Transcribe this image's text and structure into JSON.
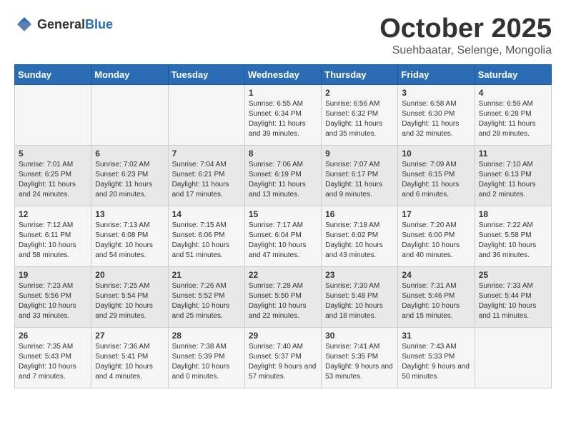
{
  "header": {
    "logo_general": "General",
    "logo_blue": "Blue",
    "month": "October 2025",
    "location": "Suehbaatar, Selenge, Mongolia"
  },
  "days_of_week": [
    "Sunday",
    "Monday",
    "Tuesday",
    "Wednesday",
    "Thursday",
    "Friday",
    "Saturday"
  ],
  "weeks": [
    [
      {
        "day": "",
        "info": ""
      },
      {
        "day": "",
        "info": ""
      },
      {
        "day": "",
        "info": ""
      },
      {
        "day": "1",
        "info": "Sunrise: 6:55 AM\nSunset: 6:34 PM\nDaylight: 11 hours\nand 39 minutes."
      },
      {
        "day": "2",
        "info": "Sunrise: 6:56 AM\nSunset: 6:32 PM\nDaylight: 11 hours\nand 35 minutes."
      },
      {
        "day": "3",
        "info": "Sunrise: 6:58 AM\nSunset: 6:30 PM\nDaylight: 11 hours\nand 32 minutes."
      },
      {
        "day": "4",
        "info": "Sunrise: 6:59 AM\nSunset: 6:28 PM\nDaylight: 11 hours\nand 28 minutes."
      }
    ],
    [
      {
        "day": "5",
        "info": "Sunrise: 7:01 AM\nSunset: 6:25 PM\nDaylight: 11 hours\nand 24 minutes."
      },
      {
        "day": "6",
        "info": "Sunrise: 7:02 AM\nSunset: 6:23 PM\nDaylight: 11 hours\nand 20 minutes."
      },
      {
        "day": "7",
        "info": "Sunrise: 7:04 AM\nSunset: 6:21 PM\nDaylight: 11 hours\nand 17 minutes."
      },
      {
        "day": "8",
        "info": "Sunrise: 7:06 AM\nSunset: 6:19 PM\nDaylight: 11 hours\nand 13 minutes."
      },
      {
        "day": "9",
        "info": "Sunrise: 7:07 AM\nSunset: 6:17 PM\nDaylight: 11 hours\nand 9 minutes."
      },
      {
        "day": "10",
        "info": "Sunrise: 7:09 AM\nSunset: 6:15 PM\nDaylight: 11 hours\nand 6 minutes."
      },
      {
        "day": "11",
        "info": "Sunrise: 7:10 AM\nSunset: 6:13 PM\nDaylight: 11 hours\nand 2 minutes."
      }
    ],
    [
      {
        "day": "12",
        "info": "Sunrise: 7:12 AM\nSunset: 6:11 PM\nDaylight: 10 hours\nand 58 minutes."
      },
      {
        "day": "13",
        "info": "Sunrise: 7:13 AM\nSunset: 6:08 PM\nDaylight: 10 hours\nand 54 minutes."
      },
      {
        "day": "14",
        "info": "Sunrise: 7:15 AM\nSunset: 6:06 PM\nDaylight: 10 hours\nand 51 minutes."
      },
      {
        "day": "15",
        "info": "Sunrise: 7:17 AM\nSunset: 6:04 PM\nDaylight: 10 hours\nand 47 minutes."
      },
      {
        "day": "16",
        "info": "Sunrise: 7:18 AM\nSunset: 6:02 PM\nDaylight: 10 hours\nand 43 minutes."
      },
      {
        "day": "17",
        "info": "Sunrise: 7:20 AM\nSunset: 6:00 PM\nDaylight: 10 hours\nand 40 minutes."
      },
      {
        "day": "18",
        "info": "Sunrise: 7:22 AM\nSunset: 5:58 PM\nDaylight: 10 hours\nand 36 minutes."
      }
    ],
    [
      {
        "day": "19",
        "info": "Sunrise: 7:23 AM\nSunset: 5:56 PM\nDaylight: 10 hours\nand 33 minutes."
      },
      {
        "day": "20",
        "info": "Sunrise: 7:25 AM\nSunset: 5:54 PM\nDaylight: 10 hours\nand 29 minutes."
      },
      {
        "day": "21",
        "info": "Sunrise: 7:26 AM\nSunset: 5:52 PM\nDaylight: 10 hours\nand 25 minutes."
      },
      {
        "day": "22",
        "info": "Sunrise: 7:28 AM\nSunset: 5:50 PM\nDaylight: 10 hours\nand 22 minutes."
      },
      {
        "day": "23",
        "info": "Sunrise: 7:30 AM\nSunset: 5:48 PM\nDaylight: 10 hours\nand 18 minutes."
      },
      {
        "day": "24",
        "info": "Sunrise: 7:31 AM\nSunset: 5:46 PM\nDaylight: 10 hours\nand 15 minutes."
      },
      {
        "day": "25",
        "info": "Sunrise: 7:33 AM\nSunset: 5:44 PM\nDaylight: 10 hours\nand 11 minutes."
      }
    ],
    [
      {
        "day": "26",
        "info": "Sunrise: 7:35 AM\nSunset: 5:43 PM\nDaylight: 10 hours\nand 7 minutes."
      },
      {
        "day": "27",
        "info": "Sunrise: 7:36 AM\nSunset: 5:41 PM\nDaylight: 10 hours\nand 4 minutes."
      },
      {
        "day": "28",
        "info": "Sunrise: 7:38 AM\nSunset: 5:39 PM\nDaylight: 10 hours\nand 0 minutes."
      },
      {
        "day": "29",
        "info": "Sunrise: 7:40 AM\nSunset: 5:37 PM\nDaylight: 9 hours\nand 57 minutes."
      },
      {
        "day": "30",
        "info": "Sunrise: 7:41 AM\nSunset: 5:35 PM\nDaylight: 9 hours\nand 53 minutes."
      },
      {
        "day": "31",
        "info": "Sunrise: 7:43 AM\nSunset: 5:33 PM\nDaylight: 9 hours\nand 50 minutes."
      },
      {
        "day": "",
        "info": ""
      }
    ]
  ]
}
